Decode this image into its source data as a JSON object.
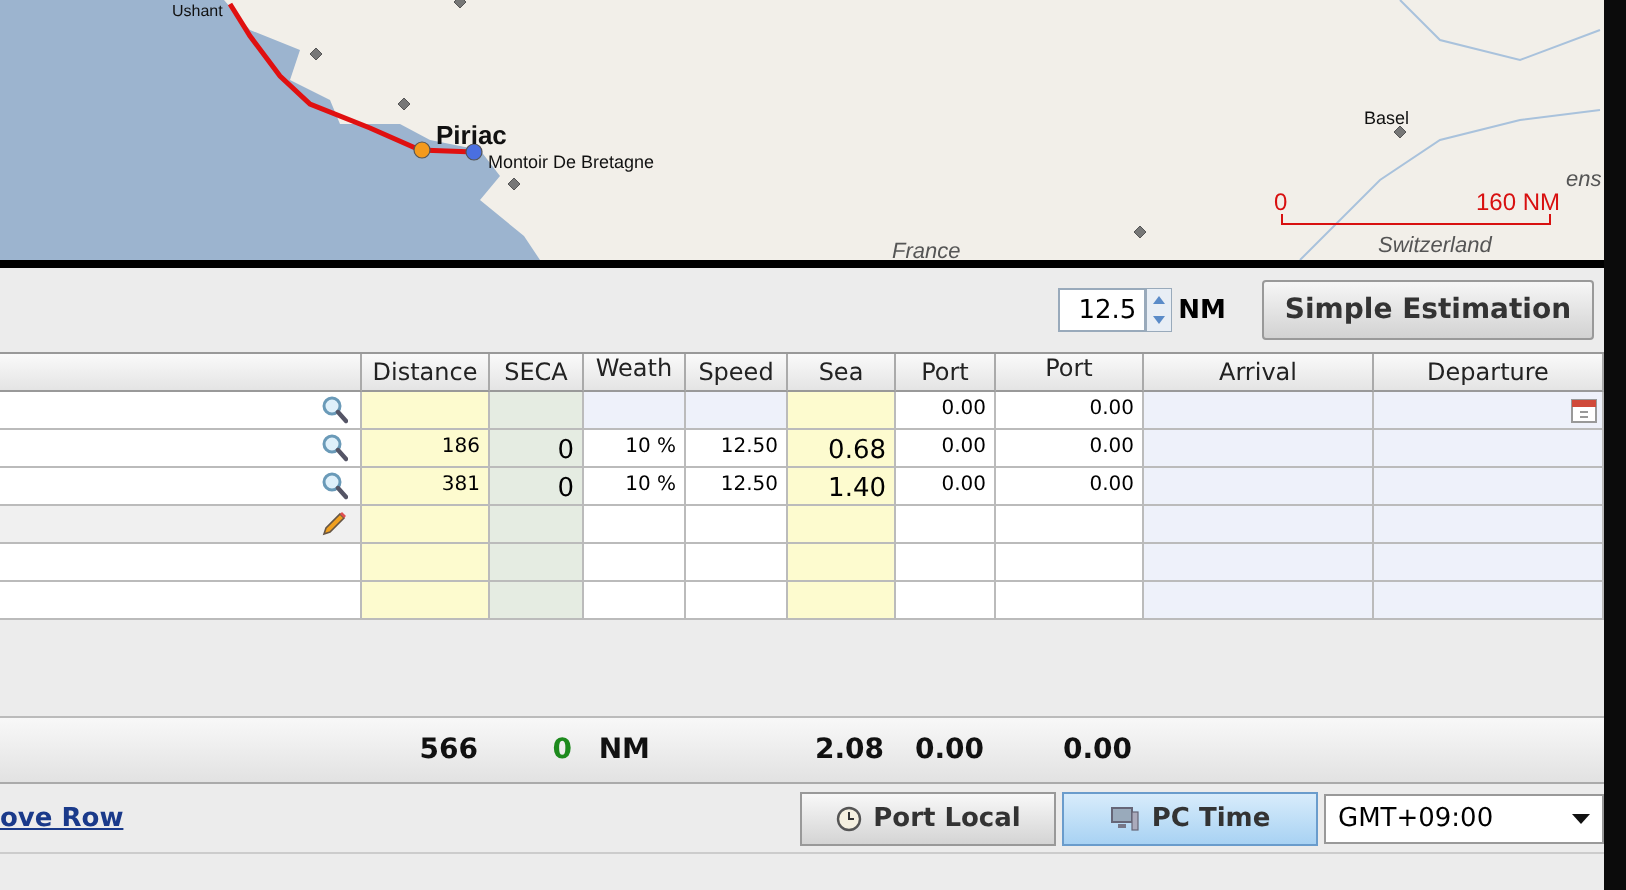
{
  "map": {
    "places": [
      {
        "name": "Ushant"
      },
      {
        "name": "Piriac"
      },
      {
        "name": "Montoir De Bretagne"
      },
      {
        "name": "Basel"
      },
      {
        "name": "France"
      },
      {
        "name": "Switzerland"
      },
      {
        "name": "ens"
      }
    ],
    "scale": {
      "start": "0",
      "end": "160 NM"
    }
  },
  "step": {
    "value": "12.5",
    "unit": "NM"
  },
  "estimate_button": "Simple Estimation",
  "table": {
    "columns": [
      "Distance",
      "SECA",
      "Weath",
      "Speed",
      "Sea",
      "Port",
      "Port",
      "Arrival",
      "Departure"
    ],
    "rows": [
      {
        "kind": "search",
        "calendar": true,
        "cells": [
          null,
          null,
          null,
          null,
          null,
          "0.00",
          "0.00",
          null,
          null
        ]
      },
      {
        "kind": "search",
        "calendar": false,
        "cells": [
          "186",
          "0",
          "10 %",
          "12.50",
          "0.68",
          "0.00",
          "0.00",
          null,
          null
        ]
      },
      {
        "kind": "search",
        "calendar": false,
        "cells": [
          "381",
          "0",
          "10 %",
          "12.50",
          "1.40",
          "0.00",
          "0.00",
          null,
          null
        ]
      },
      {
        "kind": "pencil",
        "calendar": false,
        "cells": [
          null,
          null,
          null,
          null,
          null,
          null,
          null,
          null,
          null
        ]
      },
      {
        "kind": "blank",
        "calendar": false,
        "cells": [
          null,
          null,
          null,
          null,
          null,
          null,
          null,
          null,
          null
        ]
      },
      {
        "kind": "blank",
        "calendar": false,
        "cells": [
          null,
          null,
          null,
          null,
          null,
          null,
          null,
          null,
          null
        ]
      }
    ]
  },
  "totals": [
    "566",
    "0",
    "NM",
    "2.08",
    "0.00",
    "0.00"
  ],
  "remove_link": "ove Row",
  "time_modes": [
    {
      "label": "Port Local",
      "selected": false
    },
    {
      "label": "PC Time",
      "selected": true
    }
  ],
  "timezone": "GMT+09:00"
}
